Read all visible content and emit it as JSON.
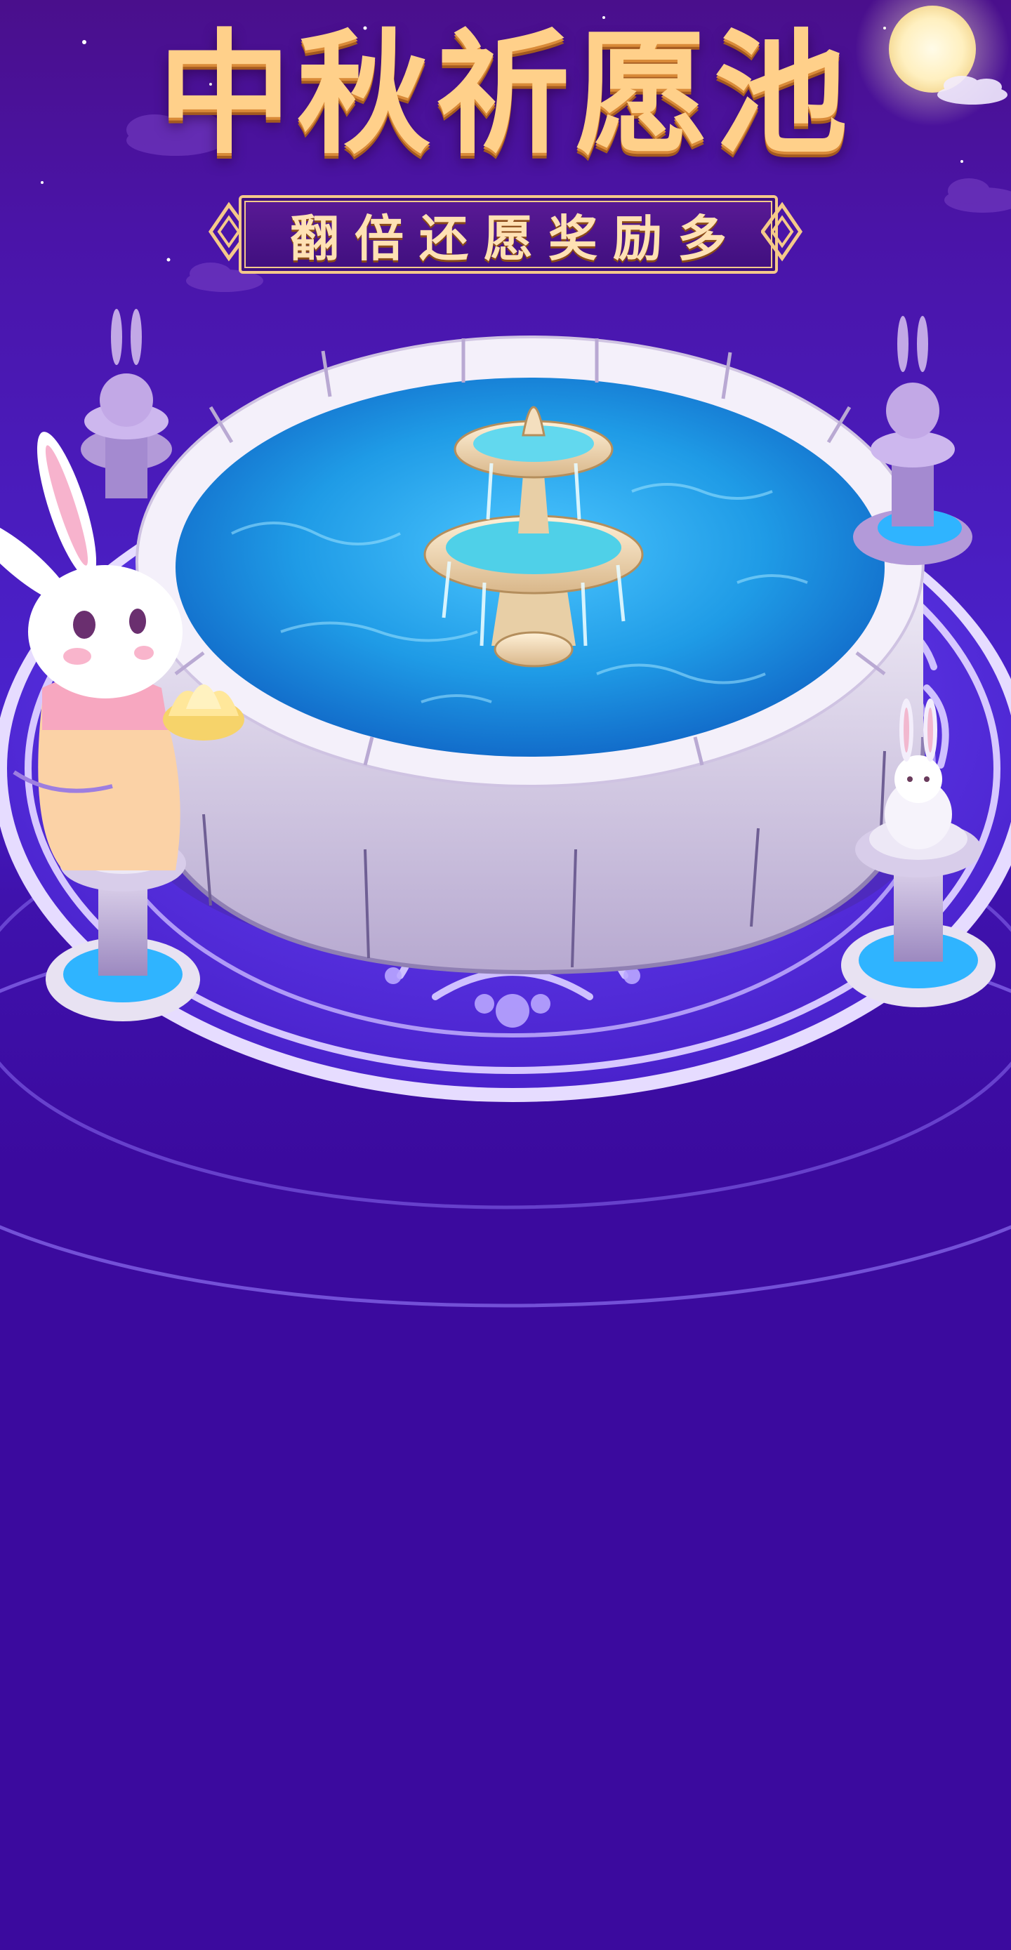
{
  "banner": {
    "title": "中秋祈愿池",
    "subtitle": "翻倍还愿奖励多"
  },
  "colors": {
    "background_top": "#4a0f8c",
    "background_bottom": "#3b0a9e",
    "title_gold": "#ffd08a",
    "water_blue": "#1f9be6",
    "stone": "#e4dcef",
    "pattern_blue": "#5a3cff"
  },
  "scene": {
    "icons": [
      "moon-icon",
      "cloud-icon",
      "fountain-icon",
      "rabbit-statue-icon",
      "moon-rabbit-icon",
      "lotus-lantern-icon"
    ]
  }
}
